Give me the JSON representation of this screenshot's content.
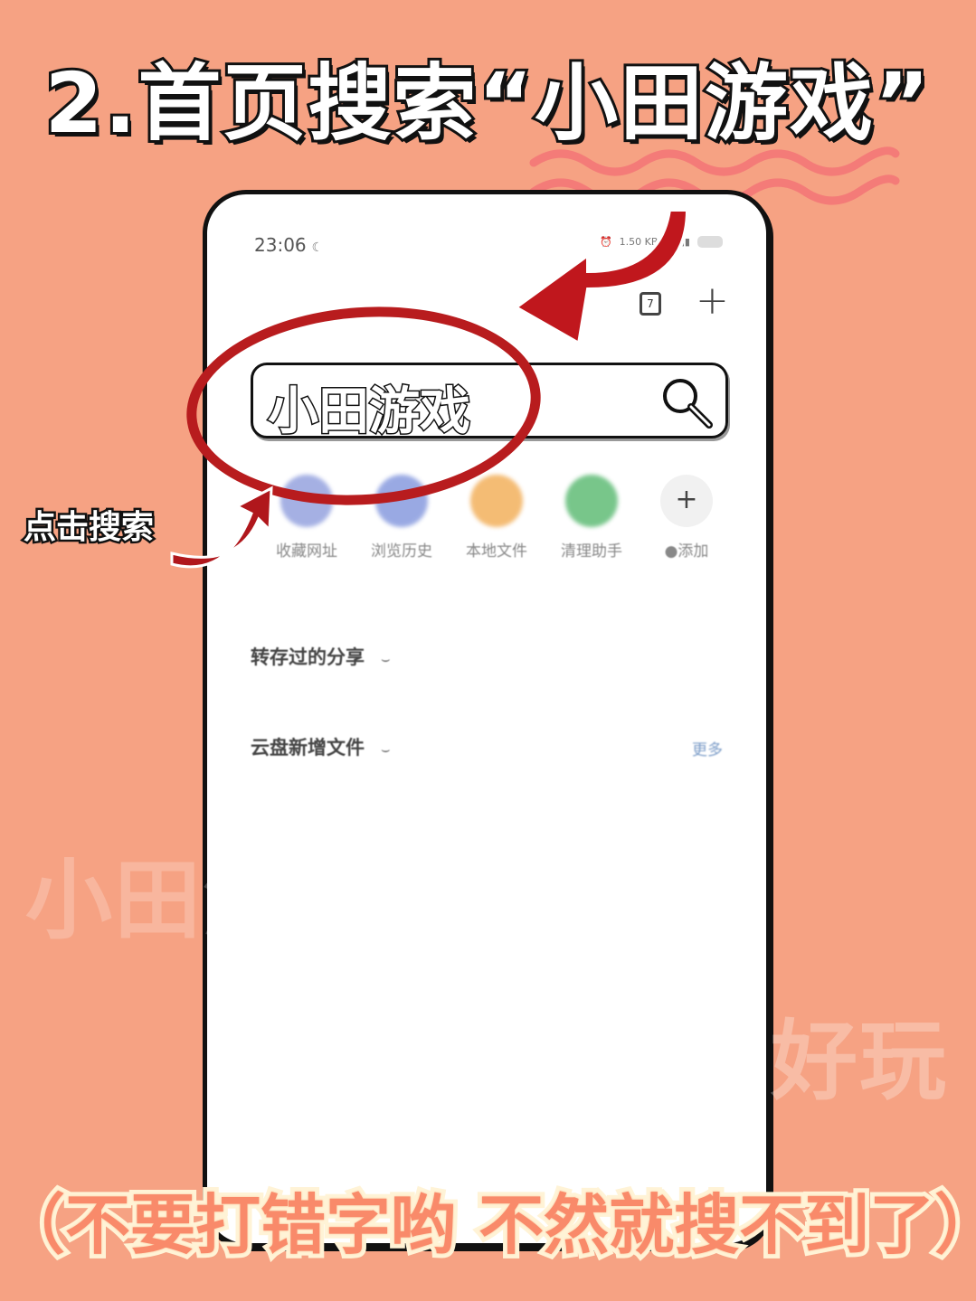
{
  "headline": "2.首页搜索“小田游戏”",
  "phone": {
    "status": {
      "time": "23:06",
      "speed": "1.50 KB/s"
    },
    "tab_count": "7",
    "search": {
      "value": "小田游戏"
    },
    "shortcuts": [
      {
        "label": "收藏网址",
        "icon": "bookmark-icon",
        "color": "#7f8fd8"
      },
      {
        "label": "浏览历史",
        "icon": "history-icon",
        "color": "#6f86d8"
      },
      {
        "label": "本地文件",
        "icon": "folder-icon",
        "color": "#f0a03a"
      },
      {
        "label": "清理助手",
        "icon": "broom-icon",
        "color": "#3fae5a"
      },
      {
        "label": "●添加",
        "icon": "plus-icon",
        "color": "#f1f1f1"
      }
    ],
    "sections": [
      {
        "title": "转存过的分享"
      },
      {
        "title": "云盘新增文件",
        "more": "更多"
      }
    ]
  },
  "annotation": {
    "side_label": "点击搜索"
  },
  "watermarks": [
    "小田游戏",
    "真的好玩"
  ],
  "bottom_note": "（不要打错字哟 不然就搜不到了）",
  "colors": {
    "background": "#f6a283",
    "accent_red": "#b81c1e"
  }
}
